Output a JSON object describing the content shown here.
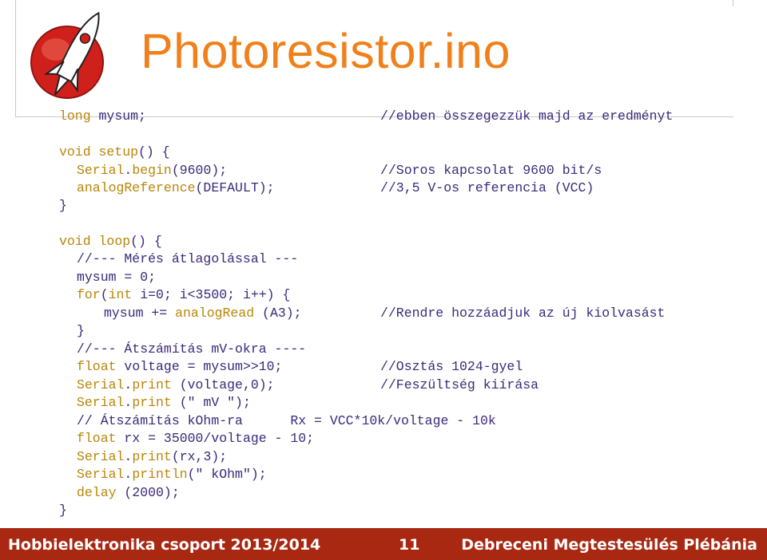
{
  "title": "Photoresistor.ino",
  "colors": {
    "title": "#f0801a",
    "keyword": "#b8860b",
    "text": "#3a2a7a",
    "footer_bg": "#a82812",
    "footer_text": "#ffffff",
    "logo_red": "#d0201c"
  },
  "logo": {
    "icon": "rocket-logo-icon"
  },
  "code": {
    "l1_kw": "long",
    "l1_rest": " mysum;",
    "l1_comment": "//ebben összegezzük majd az eredményt",
    "l2_kw": "void",
    "l2_mid": " ",
    "l2_fn": "setup",
    "l2_rest": "() {",
    "l3_obj": "Serial",
    "l3_dot": ".",
    "l3_fn": "begin",
    "l3_rest": "(9600);",
    "l3_comment": "//Soros kapcsolat 9600 bit/s",
    "l4_fn": "analogReference",
    "l4_rest": "(DEFAULT);",
    "l4_comment": "//3,5 V-os referencia (VCC)",
    "l5": "}",
    "l6_kw": "void",
    "l6_mid": " ",
    "l6_fn": "loop",
    "l6_rest": "() {",
    "l7": "//--- Mérés átlagolással ---",
    "l8": "mysum = 0;",
    "l9_kw": "for",
    "l9_paren": "(",
    "l9_kw2": "int",
    "l9_rest": " i=0; i<3500; i++) {",
    "l10_pre": "mysum += ",
    "l10_fn": "analogRead",
    "l10_rest": " (A3);",
    "l10_comment": "//Rendre hozzáadjuk az új kiolvasást",
    "l11": "}",
    "l12": "//--- Átszámítás mV-okra ----",
    "l13_kw": "float",
    "l13_rest": " voltage = mysum>>10;",
    "l13_comment": "//Osztás 1024-gyel",
    "l14_obj": "Serial",
    "l14_dot": ".",
    "l14_fn": "print",
    "l14_rest": " (voltage,0);",
    "l14_comment": "//Feszültség kiírása",
    "l15_obj": "Serial",
    "l15_dot": ".",
    "l15_fn": "print",
    "l15_rest": " (\" mV \");",
    "l16": "// Átszámítás kOhm-ra      Rx = VCC*10k/voltage - 10k",
    "l17_kw": "float",
    "l17_rest": " rx = 35000/voltage - 10;",
    "l18_obj": "Serial",
    "l18_dot": ".",
    "l18_fn": "print",
    "l18_rest": "(rx,3);",
    "l19_obj": "Serial",
    "l19_dot": ".",
    "l19_fn": "println",
    "l19_rest": "(\" kOhm\");",
    "l20_fn": "delay",
    "l20_rest": " (2000);",
    "l21": "}"
  },
  "footer": {
    "left": "Hobbielektronika csoport 2013/2014",
    "page": "11",
    "right": "Debreceni Megtestesülés Plébánia"
  }
}
